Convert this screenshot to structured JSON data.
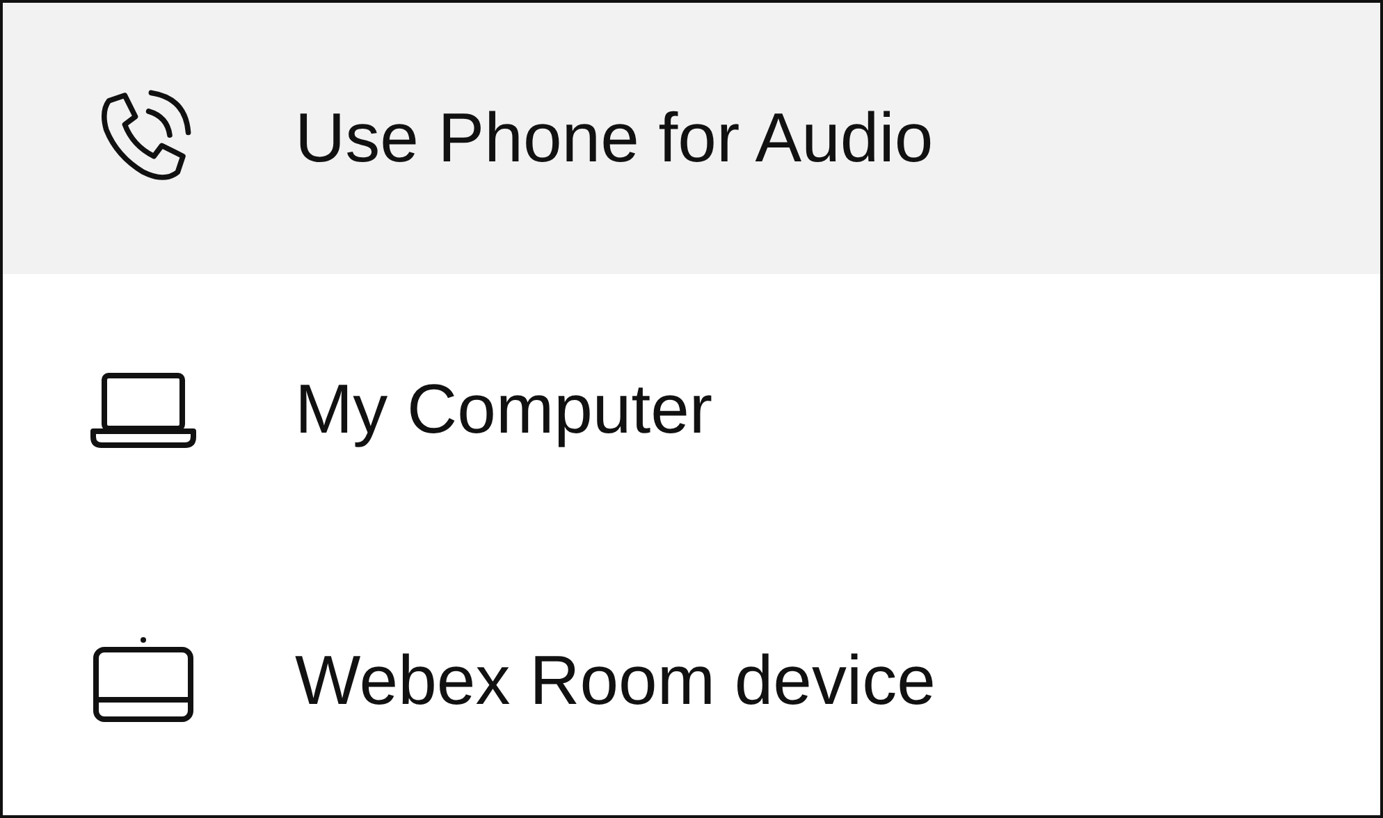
{
  "menu_items": [
    {
      "label": "Use Phone for Audio",
      "kind": "phone",
      "selected": true
    },
    {
      "label": "My Computer",
      "kind": "laptop",
      "selected": false
    },
    {
      "label": "Webex Room device",
      "kind": "room",
      "selected": false
    }
  ]
}
